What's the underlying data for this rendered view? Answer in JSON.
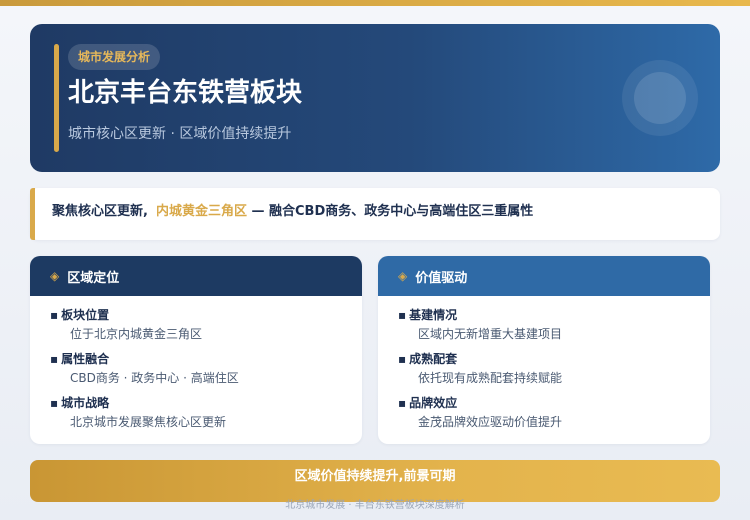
{
  "hero": {
    "tag": "城市发展分析",
    "title": "北京丰台东铁营板块",
    "subtitle": "城市核心区更新 · 区域价值持续提升"
  },
  "highlight": {
    "prefix": "聚焦核心区更新,",
    "emphasis": "内城黄金三角区",
    "suffix": " — 融合CBD商务、政务中心与高端住区三重属性"
  },
  "cards": {
    "left": {
      "icon": "diamond-icon",
      "title": "区域定位",
      "items": [
        {
          "title": "板块位置",
          "desc": "位于北京内城黄金三角区"
        },
        {
          "title": "属性融合",
          "desc": "CBD商务 · 政务中心 · 高端住区"
        },
        {
          "title": "城市战略",
          "desc": "北京城市发展聚焦核心区更新"
        }
      ]
    },
    "right": {
      "icon": "diamond-icon",
      "title": "价值驱动",
      "items": [
        {
          "title": "基建情况",
          "desc": "区域内无新增重大基建项目"
        },
        {
          "title": "成熟配套",
          "desc": "依托现有成熟配套持续赋能"
        },
        {
          "title": "品牌效应",
          "desc": "金茂品牌效应驱动价值提升"
        }
      ]
    }
  },
  "cta": "区域价值持续提升,前景可期",
  "footer": "北京城市发展 · 丰台东铁营板块深度解析",
  "colors": {
    "navy": "#1d3a62",
    "blue": "#2f6aa6",
    "gold": "#d9a94a"
  }
}
